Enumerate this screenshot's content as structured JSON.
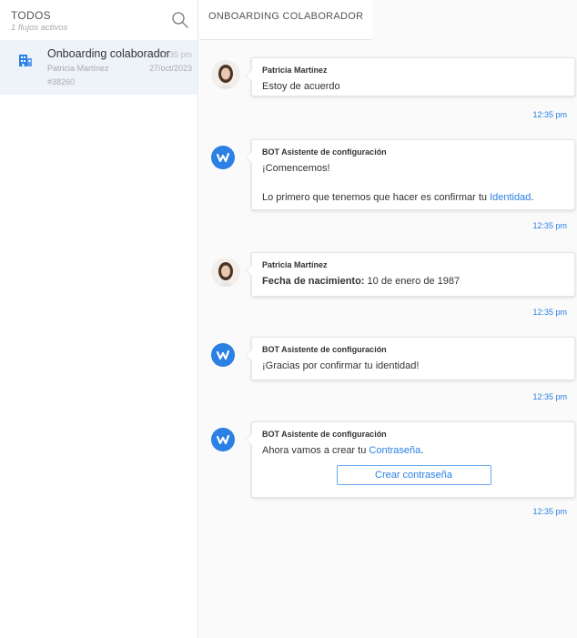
{
  "sidebar": {
    "title": "TODOS",
    "subtitle": "1 flujos activos",
    "search_icon": "search-icon",
    "item": {
      "icon": "building-icon",
      "title": "Onboarding colaborador",
      "time": "12:35 pm",
      "name": "Patricia Martínez",
      "date": "27/oct/2023",
      "id": "#38260"
    }
  },
  "main": {
    "title": "ONBOARDING COLABORADOR",
    "messages": [
      {
        "sender": "Patricia Martínez",
        "avatar": "user-avatar",
        "text": "Estoy de acuerdo",
        "time": "12:35 pm"
      },
      {
        "sender": "BOT Asistente de configuración",
        "avatar": "bot-logo-icon",
        "text1": "¡Comencemos!",
        "text2_prefix": "Lo primero que tenemos que hacer es confirmar tu",
        "text2_link": "Identidad",
        "text2_suffix": ".",
        "time": "12:35 pm"
      },
      {
        "sender": "Patricia Martínez",
        "avatar": "user-avatar",
        "label": "Fecha de nacimiento:",
        "value": "10 de enero de 1987",
        "time": "12:35 pm"
      },
      {
        "sender": "BOT Asistente de configuración",
        "avatar": "bot-logo-icon",
        "text": "¡Gracias por confirmar tu identidad!",
        "time": "12:35 pm"
      },
      {
        "sender": "BOT Asistente de configuración",
        "avatar": "bot-logo-icon",
        "text_prefix": "Ahora vamos a crear tu",
        "text_link": "Contraseña",
        "text_suffix": ".",
        "button": "Crear contraseña",
        "time": "12:35 pm"
      }
    ]
  },
  "colors": {
    "accent": "#2a80e3",
    "selected_item": "#eef3fa",
    "chat_background": "#fafafa"
  }
}
